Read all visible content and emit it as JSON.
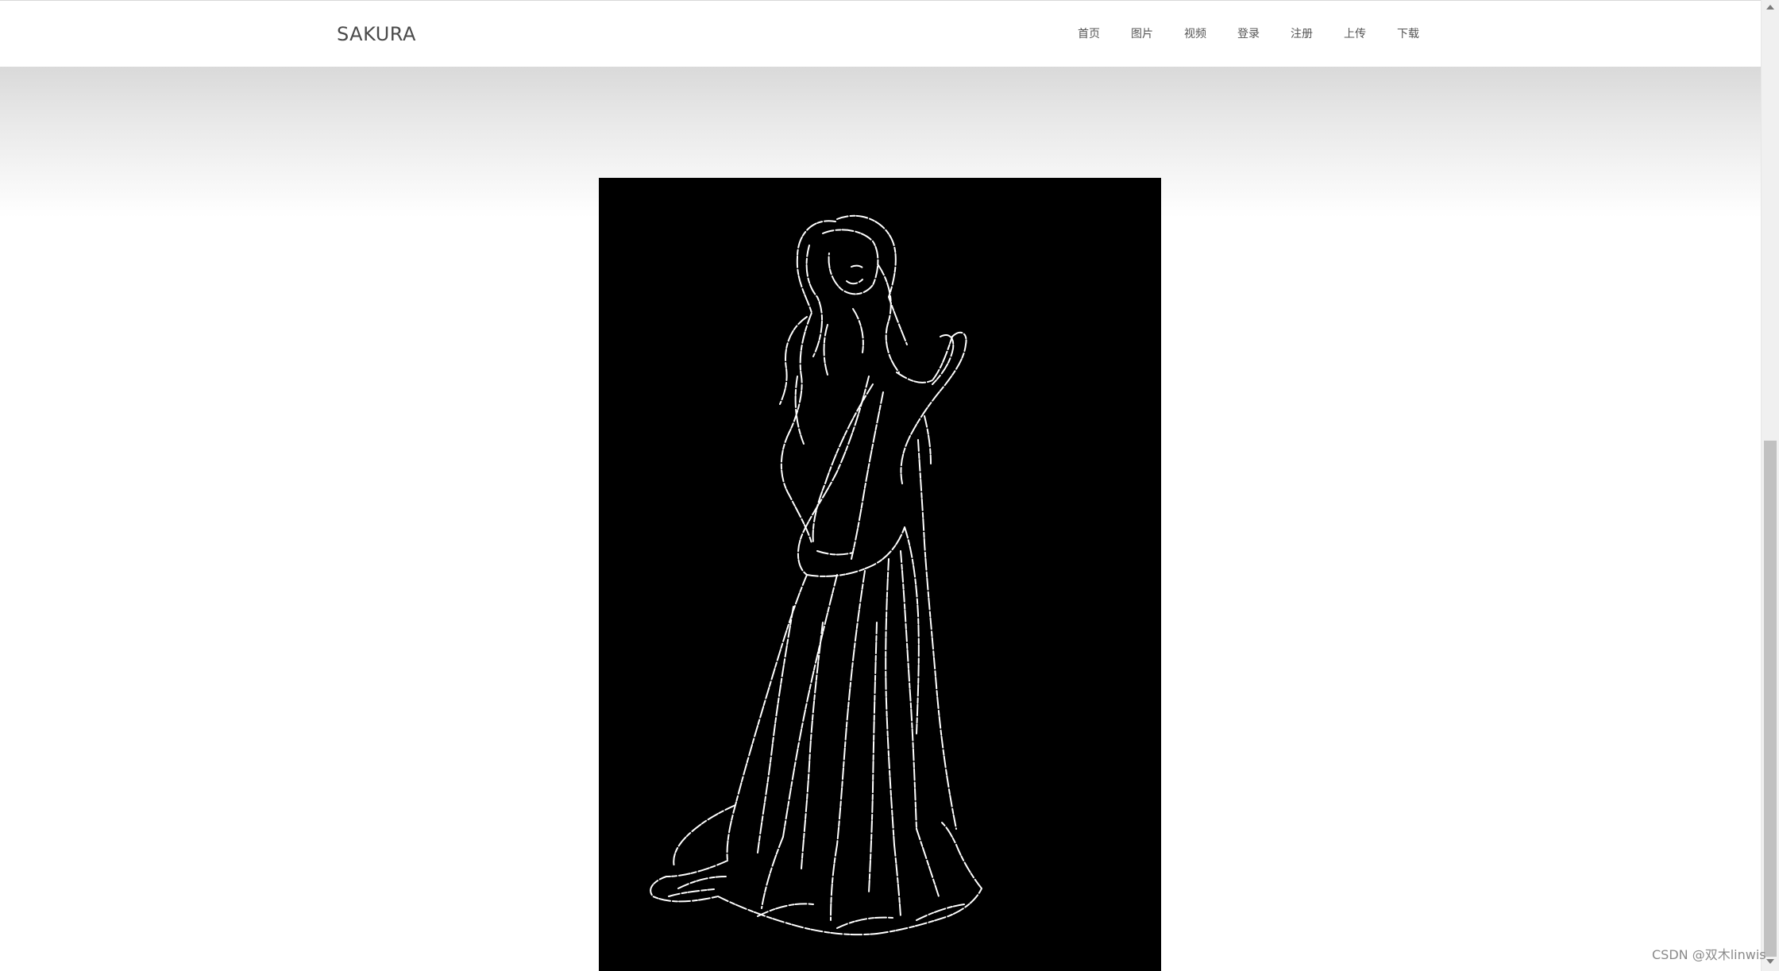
{
  "navbar": {
    "brand": "SAKURA",
    "links": [
      {
        "label": "首页"
      },
      {
        "label": "图片"
      },
      {
        "label": "视频"
      },
      {
        "label": "登录"
      },
      {
        "label": "注册"
      },
      {
        "label": "上传"
      },
      {
        "label": "下载"
      }
    ]
  },
  "main": {
    "image": {
      "subject": "edge-detected line drawing of a long-haired figure in a flowing robe, white lines on black background"
    }
  },
  "watermark": "CSDN @双木linwis",
  "colors": {
    "navbar_bg": "#ffffff",
    "brand_text": "#4a4a4a",
    "nav_text": "#555555",
    "image_bg": "#000000",
    "image_lines": "#ffffff"
  }
}
